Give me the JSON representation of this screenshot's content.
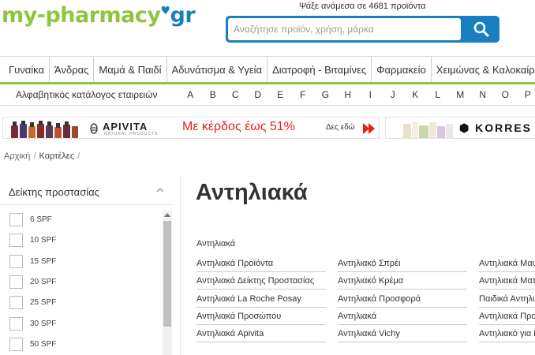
{
  "header": {
    "logo_part1": "my-pharmacy",
    "logo_part2": "gr",
    "search_hint": "Ψάξε ανάμεσα σε 4681 προϊόντα",
    "search_placeholder": "Αναζήτησε προϊόν, χρήση, μάρκα",
    "search_icon": "search-icon"
  },
  "category_nav": [
    "Γυναίκα",
    "Άνδρας",
    "Μαμά & Παιδί",
    "Αδυνάτισμα & Υγεία",
    "Διατροφή - Βιταμίνες",
    "Φαρμακείο",
    "Χειμώνας & Καλοκαίρι"
  ],
  "alpha_bar": {
    "label": "Αλφαβητικός κατάλογος εταιρειών",
    "letters": [
      "A",
      "B",
      "C",
      "D",
      "E",
      "F",
      "G",
      "H",
      "I",
      "J",
      "K",
      "L",
      "M",
      "N",
      "O",
      "P"
    ]
  },
  "banners": {
    "left": {
      "brand": "APIVITA",
      "brand_sub": "NATURAL PRODUCTS",
      "promo": "Με κέρδος έως 51%",
      "cta": "Δες εδώ"
    },
    "right": {
      "brand": "KORRES"
    }
  },
  "breadcrumb": {
    "home": "Αρχική",
    "current": "Καρτέλες"
  },
  "sidebar": {
    "filter_title": "Δείκτης προστασίας",
    "options": [
      "6 SPF",
      "10 SPF",
      "15 SPF",
      "20 SPF",
      "25 SPF",
      "30 SPF",
      "50 SPF"
    ]
  },
  "main": {
    "title": "Αντηλιακά",
    "category_label": "Αντηλιακά",
    "links": {
      "col1": [
        "Αντηλιακά Προϊόντα",
        "Αντηλιακά Δείκτης Προστασίας",
        "Αντηλιακά La Roche Posay",
        "Αντηλιακά Προσώπου",
        "Αντηλιακά Apivita"
      ],
      "col2": [
        "Αντηλιακό Σπρέι",
        "Αντηλιακό Κρέμα",
        "Αντηλιακά Προσφορά",
        "Αντηλιακά",
        "Αντηλιακά Vichy"
      ],
      "col3": [
        "Αντηλιακά Μαυρίσματος",
        "Αντηλιακά Ματ",
        "Παιδικά Αντηλιακά",
        "Αντηλιακά Προσώπου",
        "Αντηλιακό για Πρόσωπο"
      ]
    }
  },
  "colors": {
    "brand_green": "#8cc63f",
    "brand_blue": "#1a7fc1",
    "promo_red": "#e2231a"
  }
}
